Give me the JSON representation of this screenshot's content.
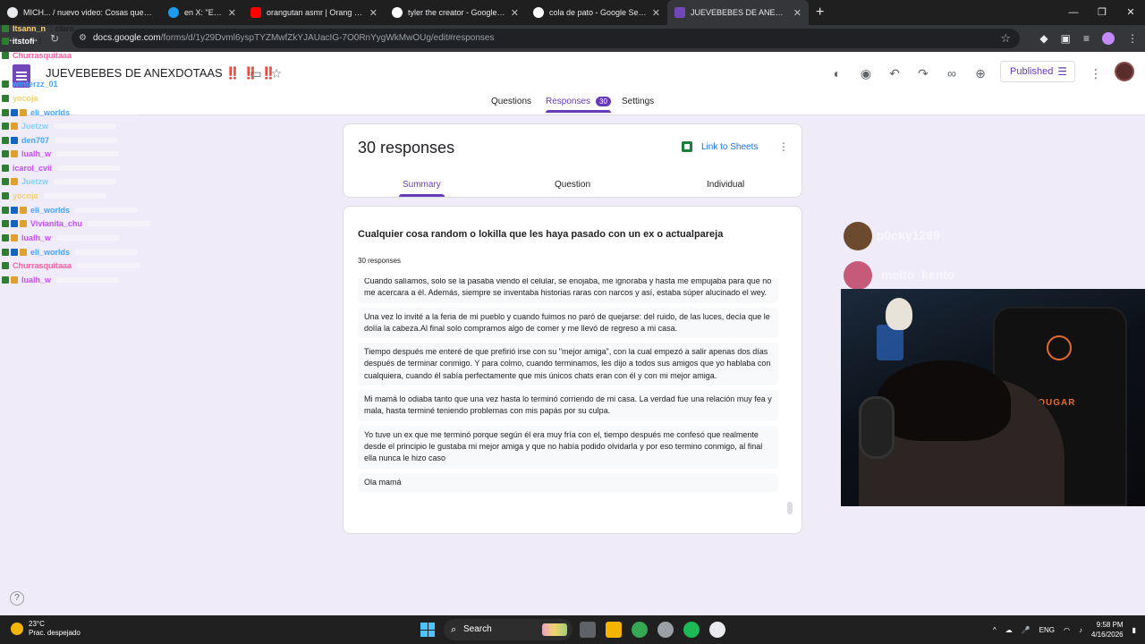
{
  "browser": {
    "tabs": [
      {
        "title": "MICH... / nuevo video: Cosas que te crees tener un letrago",
        "active": false,
        "color": "#e8eaed"
      },
      {
        "title": "en X: \"Esto confi",
        "active": false,
        "color": "#1d9bf0"
      },
      {
        "title": "orangutan asmr | Orang Utan A",
        "active": false,
        "color": "#ff0000"
      },
      {
        "title": "tyler the creator - Google Searc",
        "active": false,
        "color": "#ffffff"
      },
      {
        "title": "cola de pato - Google Search",
        "active": false,
        "color": "#ffffff"
      },
      {
        "title": "JUEVEBEBES DE ANEXDOTAAS!",
        "active": true,
        "color": "#7248b9"
      }
    ],
    "new_tab": "+",
    "url_host": "docs.google.com",
    "url_path": "/forms/d/1y29Dvml6yspTYZMwfZkYJAUacIG-7O0RnYygWkMwOUg/edit#responses"
  },
  "form": {
    "title": "JUEVEBEBES DE ANEXDOTAAS",
    "title_marks": "‼️ ‼️ ‼️",
    "published_label": "Published",
    "tabs": {
      "questions": "Questions",
      "responses": "Responses",
      "responses_count": "30",
      "settings": "Settings"
    }
  },
  "summary_card": {
    "count_label": "30 responses",
    "link_sheets": "Link to Sheets",
    "tabs": {
      "summary": "Summary",
      "question": "Question",
      "individual": "Individual"
    }
  },
  "question_card": {
    "title": "Cualquier cosa random o lokilla que les haya pasado con un ex o actualpareja",
    "count": "30 responses",
    "answers": [
      "Cuando salíamos, solo se la pasaba viendo el celular, se enojaba, me ignoraba y hasta me empujaba para que no me acercara a él. Además, siempre se inventaba historias raras con narcos y así, estaba súper alucinado el wey.",
      "Una vez lo invité a la feria de mi pueblo y cuando fuimos no paró de quejarse: del ruido, de las luces, decía que le dolía la cabeza.Al final solo compramos algo de comer y me llevó de regreso a mi casa.",
      "Tiempo después me enteré de que prefirió irse con su \"mejor amiga\", con la cual empezó a salir apenas dos días después de terminar conmigo. Y para colmo, cuando terminamos, les dijo a todos sus amigos que yo hablaba con cualquiera, cuando él sabía perfectamente que mis únicos chats eran con él y con mi mejor amiga.",
      "Mi mamá lo odiaba tanto que una vez hasta lo terminó corriendo de mi casa. La verdad fue una relación muy fea y mala, hasta terminé teniendo problemas con mis papás por su culpa.",
      "Yo tuve un ex que me terminó porque según él era muy fría con el, tiempo después me confesó que realmente desde el principio le gustaba mi mejor amiga y que no había podido olvidarla y por eso termino conmigo, al final ella nunca le hizo caso",
      "Ola mamá"
    ]
  },
  "chat": [
    {
      "user": "Itsann_n",
      "msg": ": claro",
      "color": "#ffd166",
      "badges": [
        "#2e7d32"
      ]
    },
    {
      "user": "itstofi",
      "msg": ":",
      "color": "#ffffff",
      "badges": [
        "#2e7d32"
      ]
    },
    {
      "user": "Churrasquitaaa",
      "msg": "",
      "color": "#ff5fa2",
      "badges": [
        "#2e7d32"
      ]
    },
    {
      "user": "winterzz_01",
      "msg": "",
      "color": "#4aa3ff",
      "badges": [
        "#2e7d32"
      ]
    },
    {
      "user": "yocoja",
      "msg": "",
      "color": "#f3d36b",
      "badges": [
        "#2e7d32"
      ]
    },
    {
      "user": "eli_worlds",
      "msg": "",
      "color": "#4aa3ff",
      "badges": [
        "#2e7d32",
        "#1565c0",
        "#e0a030"
      ]
    },
    {
      "user": "Juetzw",
      "msg": "",
      "color": "#7cd3ff",
      "badges": [
        "#2e7d32",
        "#e0a030"
      ]
    },
    {
      "user": "den707",
      "msg": "",
      "color": "#4aa3ff",
      "badges": [
        "#2e7d32",
        "#1565c0"
      ]
    },
    {
      "user": "lualh_w",
      "msg": "",
      "color": "#c44dff",
      "badges": [
        "#2e7d32",
        "#e0a030"
      ]
    },
    {
      "user": "icarol_cvii",
      "msg": "",
      "color": "#c44dff",
      "badges": [
        "#2e7d32"
      ]
    },
    {
      "user": "Juetzw",
      "msg": "",
      "color": "#7cd3ff",
      "badges": [
        "#2e7d32",
        "#e0a030"
      ]
    },
    {
      "user": "yocoja",
      "msg": "",
      "color": "#f3d36b",
      "badges": [
        "#2e7d32"
      ]
    },
    {
      "user": "eli_worlds",
      "msg": "",
      "color": "#4aa3ff",
      "badges": [
        "#2e7d32",
        "#1565c0",
        "#e0a030"
      ]
    },
    {
      "user": "Vivianita_chu",
      "msg": "",
      "color": "#c44dff",
      "badges": [
        "#2e7d32",
        "#1565c0",
        "#e0a030"
      ]
    },
    {
      "user": "lualh_w",
      "msg": "",
      "color": "#c44dff",
      "badges": [
        "#2e7d32",
        "#e0a030"
      ]
    },
    {
      "user": "eli_worlds",
      "msg": "",
      "color": "#4aa3ff",
      "badges": [
        "#2e7d32",
        "#1565c0",
        "#e0a030"
      ]
    },
    {
      "user": "Churrasquitaaa",
      "msg": "",
      "color": "#ff5fa2",
      "badges": [
        "#2e7d32"
      ]
    },
    {
      "user": "lualh_w",
      "msg": "",
      "color": "#c44dff",
      "badges": [
        "#2e7d32",
        "#e0a030"
      ]
    }
  ],
  "overlay": {
    "viewer1": "p0cky1299",
    "viewer2": "melto_kento",
    "chair_brand": "COUGAR"
  },
  "taskbar": {
    "temp": "23°C",
    "weather": "Prac. despejado",
    "search": "Search",
    "lang": "ENG",
    "time": "9:58 PM",
    "date": "4/16/2026"
  },
  "colors": {
    "accent": "#673ab7",
    "background": "#f0ebf8",
    "link": "#1a73e8",
    "sheets_green": "#188038"
  }
}
